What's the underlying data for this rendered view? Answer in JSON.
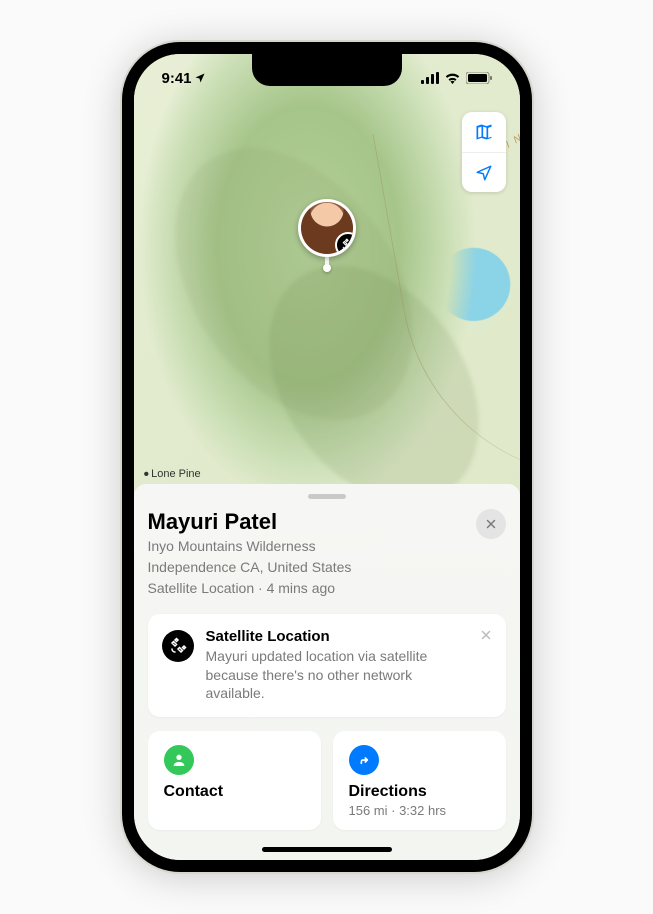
{
  "status": {
    "time": "9:41"
  },
  "map": {
    "label_lonepine": "Lone Pine",
    "label_salin": "SALIN"
  },
  "person": {
    "name": "Mayuri Patel",
    "line1": "Inyo Mountains Wilderness",
    "line2": "Independence CA, United States",
    "line3": "Satellite Location · 4 mins ago"
  },
  "satellite": {
    "title": "Satellite Location",
    "body": "Mayuri updated location via satellite because there's no other network available."
  },
  "actions": {
    "contact": {
      "title": "Contact"
    },
    "directions": {
      "title": "Directions",
      "sub": "156 mi · 3:32 hrs"
    }
  }
}
